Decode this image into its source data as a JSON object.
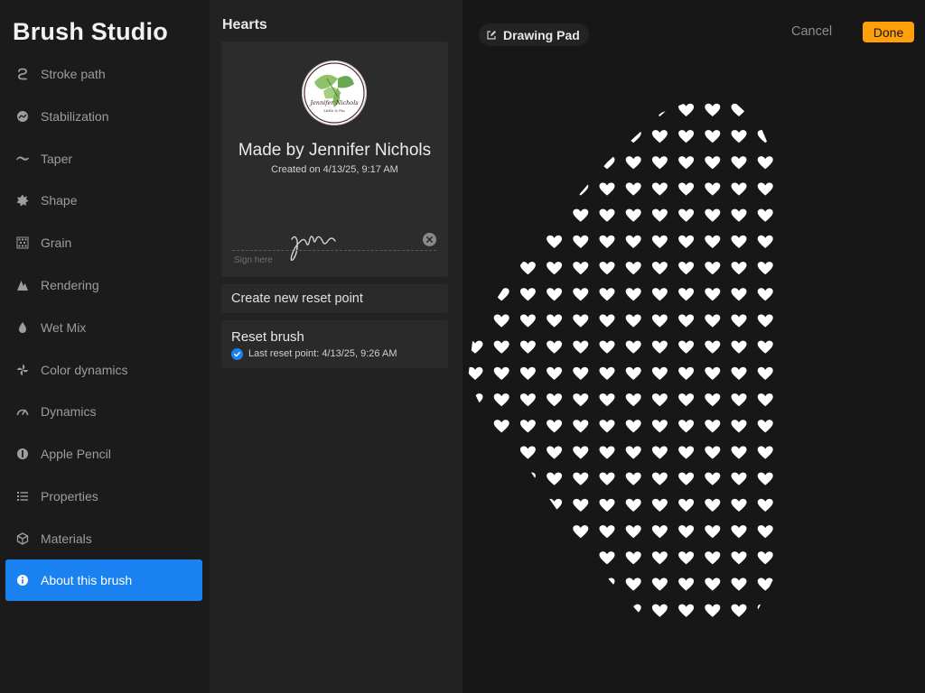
{
  "app": {
    "title": "Brush Studio"
  },
  "sidebar": {
    "items": [
      {
        "label": "Stroke path",
        "icon": "stroke-path-icon"
      },
      {
        "label": "Stabilization",
        "icon": "stabilization-icon"
      },
      {
        "label": "Taper",
        "icon": "taper-icon"
      },
      {
        "label": "Shape",
        "icon": "shape-icon"
      },
      {
        "label": "Grain",
        "icon": "grain-icon"
      },
      {
        "label": "Rendering",
        "icon": "rendering-icon"
      },
      {
        "label": "Wet Mix",
        "icon": "wet-mix-icon"
      },
      {
        "label": "Color dynamics",
        "icon": "color-dynamics-icon"
      },
      {
        "label": "Dynamics",
        "icon": "dynamics-icon"
      },
      {
        "label": "Apple Pencil",
        "icon": "apple-pencil-icon"
      },
      {
        "label": "Properties",
        "icon": "properties-icon"
      },
      {
        "label": "Materials",
        "icon": "materials-icon"
      },
      {
        "label": "About this brush",
        "icon": "info-icon",
        "active": true
      }
    ]
  },
  "about": {
    "brush_name": "Hearts",
    "logo_text": "Jennifer Nichols",
    "logo_subtext": "Little & Pin",
    "maker": "Made by Jennifer Nichols",
    "created": "Created on 4/13/25, 9:17 AM",
    "sign_here": "Sign here",
    "create_reset_point": "Create new reset point",
    "reset_brush": "Reset brush",
    "last_reset": "Last reset point: 4/13/25, 9:26 AM"
  },
  "drawing_pad": {
    "label": "Drawing Pad",
    "cancel": "Cancel",
    "done": "Done"
  },
  "colors": {
    "accent": "#1a82f0",
    "done": "#ff9f0a",
    "heart": "#ffffff"
  }
}
